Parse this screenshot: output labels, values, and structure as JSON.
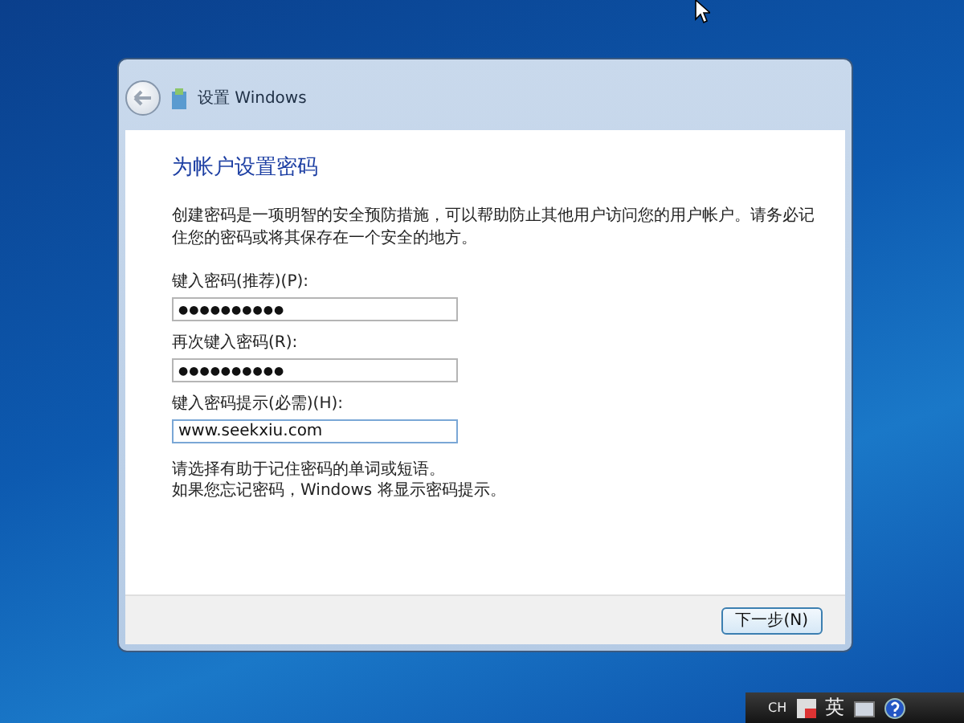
{
  "window": {
    "title": "设置 Windows"
  },
  "page": {
    "heading": "为帐户设置密码",
    "description": "创建密码是一项明智的安全预防措施，可以帮助防止其他用户访问您的用户帐户。请务必记住您的密码或将其保存在一个安全的地方。",
    "fields": [
      {
        "label": "键入密码(推荐)(P):",
        "value": "●●●●●●●●●●",
        "kind": "password",
        "focused": false
      },
      {
        "label": "再次键入密码(R):",
        "value": "●●●●●●●●●●",
        "kind": "password",
        "focused": false
      },
      {
        "label": "键入密码提示(必需)(H):",
        "value": "www.seekxiu.com",
        "kind": "text",
        "focused": true
      }
    ],
    "notes": [
      "请选择有助于记住密码的单词或短语。",
      "如果您忘记密码，Windows 将显示密码提示。"
    ]
  },
  "footer": {
    "button": "下一步(N)"
  },
  "language_bar": {
    "language": "CH",
    "mode": "英"
  }
}
